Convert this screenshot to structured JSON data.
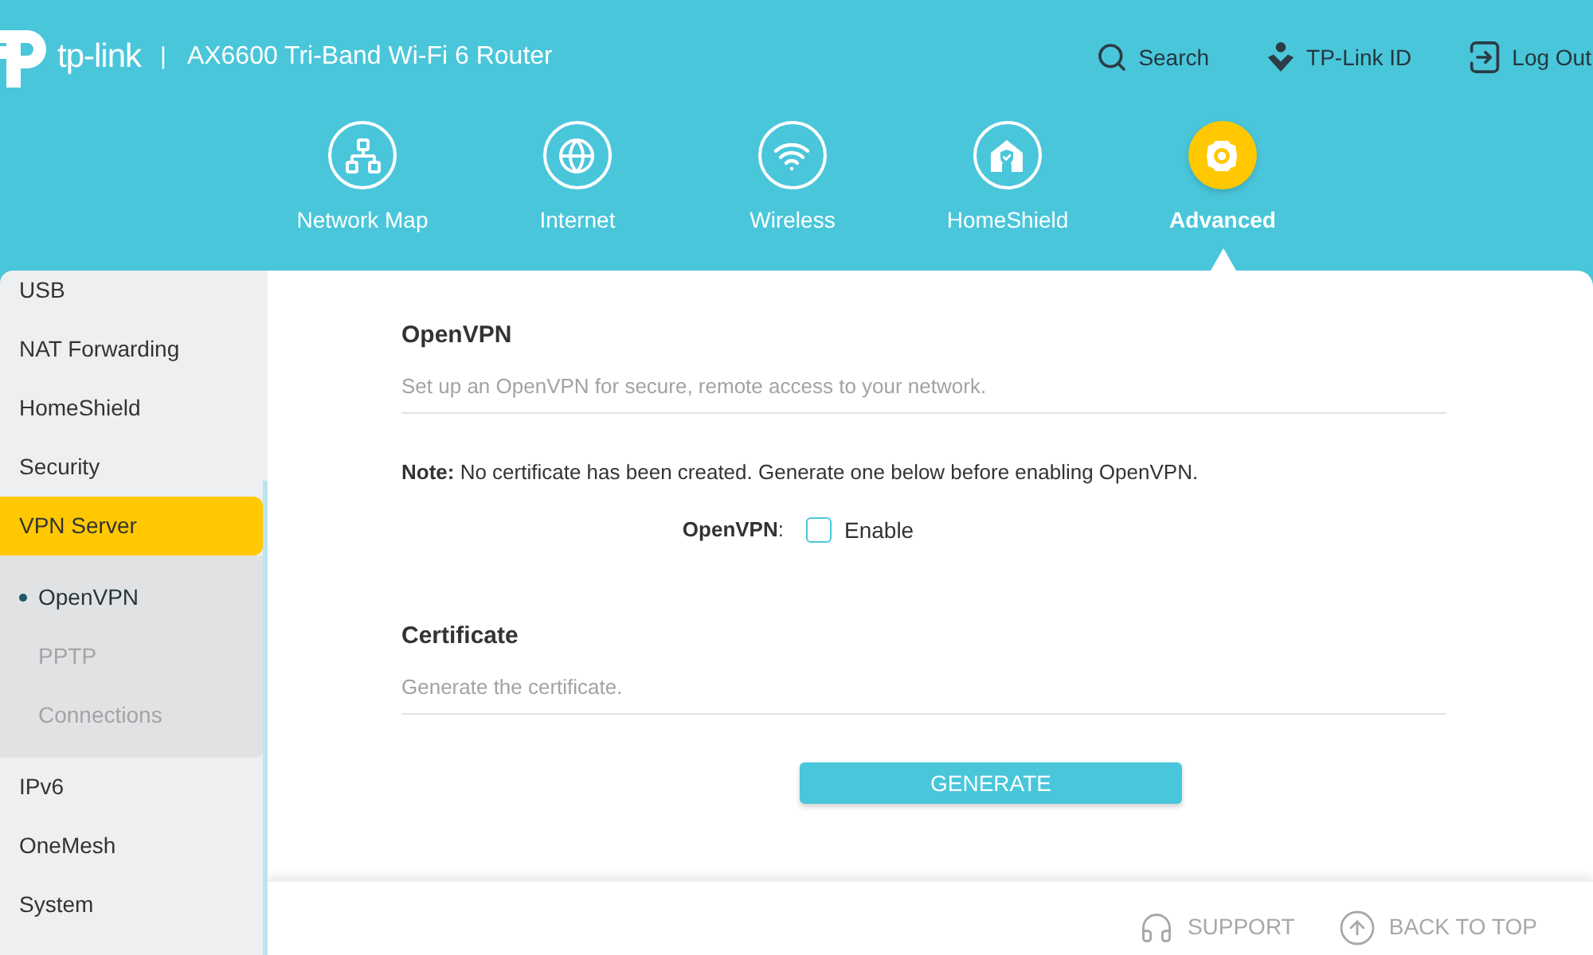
{
  "header": {
    "brand": "tp-link",
    "separator": "|",
    "model": "AX6600 Tri-Band Wi-Fi 6 Router",
    "links": [
      {
        "kind": "search",
        "label": "Search"
      },
      {
        "kind": "account",
        "label": "TP-Link ID"
      },
      {
        "kind": "logout",
        "label": "Log Out"
      }
    ]
  },
  "nav": [
    {
      "kind": "network",
      "label": "Network Map",
      "selected": false
    },
    {
      "kind": "internet",
      "label": "Internet",
      "selected": false
    },
    {
      "kind": "wireless",
      "label": "Wireless",
      "selected": false
    },
    {
      "kind": "shield",
      "label": "HomeShield",
      "selected": false
    },
    {
      "kind": "advanced",
      "label": "Advanced",
      "selected": true
    }
  ],
  "sidebar": {
    "items": [
      {
        "label": "USB",
        "selected": false,
        "expanded": false
      },
      {
        "label": "NAT Forwarding",
        "selected": false,
        "expanded": false
      },
      {
        "label": "HomeShield",
        "selected": false,
        "expanded": false
      },
      {
        "label": "Security",
        "selected": false,
        "expanded": false
      },
      {
        "label": "VPN Server",
        "selected": true,
        "expanded": true,
        "children": [
          {
            "label": "OpenVPN",
            "selected": true
          },
          {
            "label": "PPTP",
            "selected": false
          },
          {
            "label": "Connections",
            "selected": false
          }
        ]
      },
      {
        "label": "IPv6",
        "selected": false,
        "expanded": false
      },
      {
        "label": "OneMesh",
        "selected": false,
        "expanded": false
      },
      {
        "label": "System",
        "selected": false,
        "expanded": false
      }
    ]
  },
  "sections": [
    {
      "title": "OpenVPN",
      "description": "Set up an OpenVPN for secure, remote access to your network.",
      "note": "**Note:** No certificate has been created. Generate one below before enabling OpenVPN.",
      "fields": [
        {
          "label": "**OpenVPN**:",
          "option": "Enable",
          "checked": false
        }
      ]
    },
    {
      "title": "Certificate",
      "description": "Generate the certificate.",
      "button": "GENERATE"
    }
  ],
  "footer": {
    "links": [
      {
        "kind": "support",
        "label": "SUPPORT"
      },
      {
        "kind": "top",
        "label": "BACK TO TOP"
      }
    ]
  }
}
